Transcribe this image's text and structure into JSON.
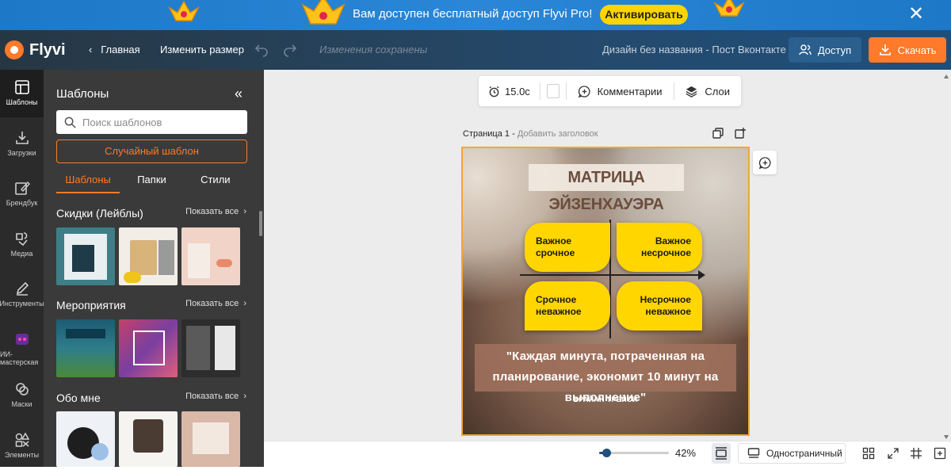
{
  "promo": {
    "text": "Вам доступен бесплатный доступ Flyvi Pro!",
    "cta": "Активировать"
  },
  "topbar": {
    "logo": "Flyvi",
    "home": "Главная",
    "resize": "Изменить размер",
    "saved_status": "Изменения сохранены",
    "doc_name": "Дизайн без названия - Пост Вконтакте ...",
    "share": "Доступ",
    "download": "Скачать"
  },
  "rail": {
    "items": [
      {
        "label": "Шаблоны",
        "icon": "templates-icon"
      },
      {
        "label": "Загрузки",
        "icon": "upload-icon"
      },
      {
        "label": "Брендбук",
        "icon": "brandbook-icon"
      },
      {
        "label": "Медиа",
        "icon": "media-icon"
      },
      {
        "label": "Инструменты",
        "icon": "pen-icon"
      },
      {
        "label": "ИИ-мастерская",
        "icon": "ai-icon"
      },
      {
        "label": "Маски",
        "icon": "masks-icon"
      },
      {
        "label": "Элементы",
        "icon": "elements-icon"
      }
    ]
  },
  "panel": {
    "title": "Шаблоны",
    "search_placeholder": "Поиск шаблонов",
    "random": "Случайный шаблон",
    "tabs": [
      "Шаблоны",
      "Папки",
      "Стили"
    ],
    "show_all": "Показать все",
    "sections": [
      {
        "name": "Скидки (Лейблы)"
      },
      {
        "name": "Мероприятия"
      },
      {
        "name": "Обо мне"
      }
    ]
  },
  "toolbar": {
    "duration": "15.0с",
    "comments": "Комментарии",
    "layers": "Слои"
  },
  "page": {
    "label": "Страница 1 -",
    "add_title": "Добавить заголовок"
  },
  "design": {
    "title": "МАТРИЦА ЭЙЗЕНХАУЭРА",
    "q1": "Важное срочное",
    "q2": "Важное несрочное",
    "q3": "Срочное неважное",
    "q4": "Несрочное неважное",
    "quote": "\"Каждая минута, потраченная на планирование, экономит 10 минут на выполнение\"",
    "author": "БРАЙАН ТРЕЙСИ"
  },
  "bottom": {
    "zoom": "42%",
    "zoom_fraction": 0.1,
    "single_page": "Одностраничный"
  },
  "colors": {
    "accent": "#ff7a2a",
    "promo_bg": "#2a86d6",
    "topbar_bg": "#25496b",
    "panel_bg": "#3a3a3a",
    "quad_yellow": "#ffd600"
  }
}
